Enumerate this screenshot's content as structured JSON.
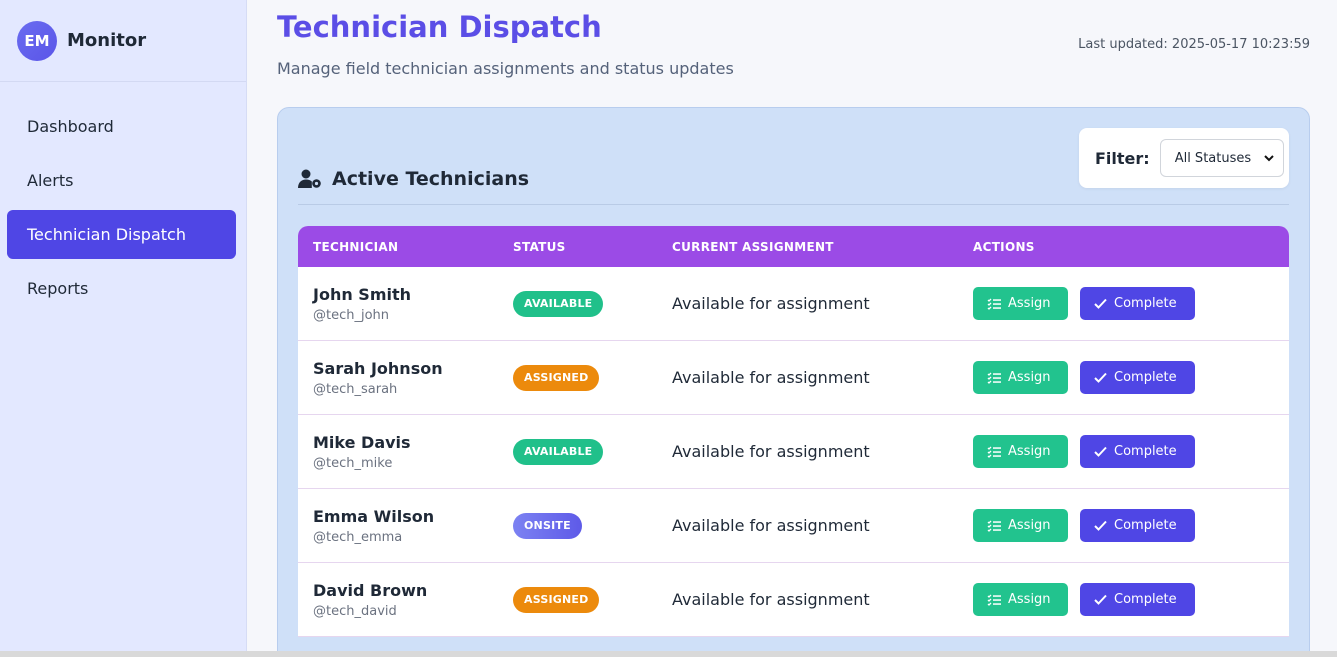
{
  "sidebar": {
    "brand_initials": "EM",
    "brand_name": "Monitor",
    "items": [
      {
        "label": "Dashboard",
        "active": false
      },
      {
        "label": "Alerts",
        "active": false
      },
      {
        "label": "Technician Dispatch",
        "active": true
      },
      {
        "label": "Reports",
        "active": false
      }
    ]
  },
  "header": {
    "title": "Technician Dispatch",
    "subtitle": "Manage field technician assignments and status updates",
    "last_updated": "Last updated: 2025-05-17 10:23:59"
  },
  "card": {
    "title": "Active Technicians",
    "title_icon": "user-gear-icon",
    "filter_label": "Filter:",
    "filter_value": "All Statuses"
  },
  "table": {
    "headers": [
      "TECHNICIAN",
      "STATUS",
      "CURRENT ASSIGNMENT",
      "ACTIONS"
    ],
    "rows": [
      {
        "name": "John Smith",
        "handle": "@tech_john",
        "status": "AVAILABLE",
        "assignment": "Available for assignment"
      },
      {
        "name": "Sarah Johnson",
        "handle": "@tech_sarah",
        "status": "ASSIGNED",
        "assignment": "Available for assignment"
      },
      {
        "name": "Mike Davis",
        "handle": "@tech_mike",
        "status": "AVAILABLE",
        "assignment": "Available for assignment"
      },
      {
        "name": "Emma Wilson",
        "handle": "@tech_emma",
        "status": "ONSITE",
        "assignment": "Available for assignment"
      },
      {
        "name": "David Brown",
        "handle": "@tech_david",
        "status": "ASSIGNED",
        "assignment": "Available for assignment"
      }
    ],
    "assign_label": "Assign",
    "complete_label": "Complete"
  },
  "colors": {
    "primary": "#4f46e5",
    "title": "#5b4ee6",
    "table_header": "#9b4be6",
    "available": "#20c08a",
    "assigned": "#ec8a0c",
    "onsite": "#6b6ef0"
  }
}
